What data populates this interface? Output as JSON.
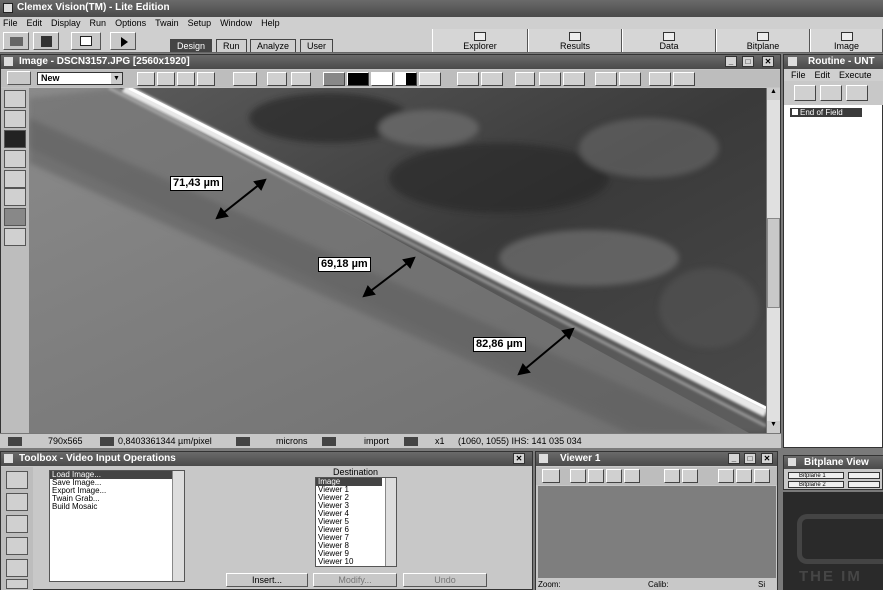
{
  "app": {
    "title": "Clemex Vision(TM) - Lite Edition",
    "menu": [
      "File",
      "Edit",
      "Display",
      "Run",
      "Options",
      "Twain",
      "Setup",
      "Window",
      "Help"
    ],
    "mode_tabs": [
      "Design",
      "Run",
      "Analyze",
      "User"
    ],
    "top_buttons": [
      "Explorer",
      "Results",
      "Data",
      "Bitplane",
      "Image"
    ]
  },
  "image_window": {
    "title": "Image - DSCN3157.JPG [2560x1920]",
    "select_value": "New",
    "measurements": [
      {
        "label": "71,43 µm"
      },
      {
        "label": "69,18 µm"
      },
      {
        "label": "82,86 µm"
      }
    ],
    "status": {
      "size": "790x565",
      "calibration": "0,8403361344 µm/pixel",
      "unit": "microns",
      "source": "import",
      "zoom": "x1",
      "position": "(1060, 1055) IHS: 141 035 034"
    }
  },
  "routine_window": {
    "title": "Routine - UNT",
    "menu": [
      "File",
      "Edit",
      "Execute"
    ],
    "items": [
      "End of Field"
    ]
  },
  "toolbox": {
    "title": "Toolbox - Video Input Operations",
    "operations": [
      "Load Image...",
      "Save Image...",
      "Export Image...",
      "Twain Grab...",
      "Build Mosaic"
    ],
    "destination_label": "Destination",
    "destinations": [
      "Image",
      "Viewer 1",
      "Viewer 2",
      "Viewer 3",
      "Viewer 4",
      "Viewer 5",
      "Viewer 6",
      "Viewer 7",
      "Viewer 8",
      "Viewer 9",
      "Viewer 10"
    ],
    "buttons": [
      "Insert...",
      "Modify...",
      "Undo"
    ]
  },
  "viewer_window": {
    "title": "Viewer 1",
    "zoom_label": "Zoom:",
    "calib_label": "Calib:",
    "size_label": "Si"
  },
  "bitplane_window": {
    "title": "Bitplane View",
    "items": [
      "Bitplane 1",
      "Bitplane 2"
    ]
  },
  "background_text": "THE IM"
}
